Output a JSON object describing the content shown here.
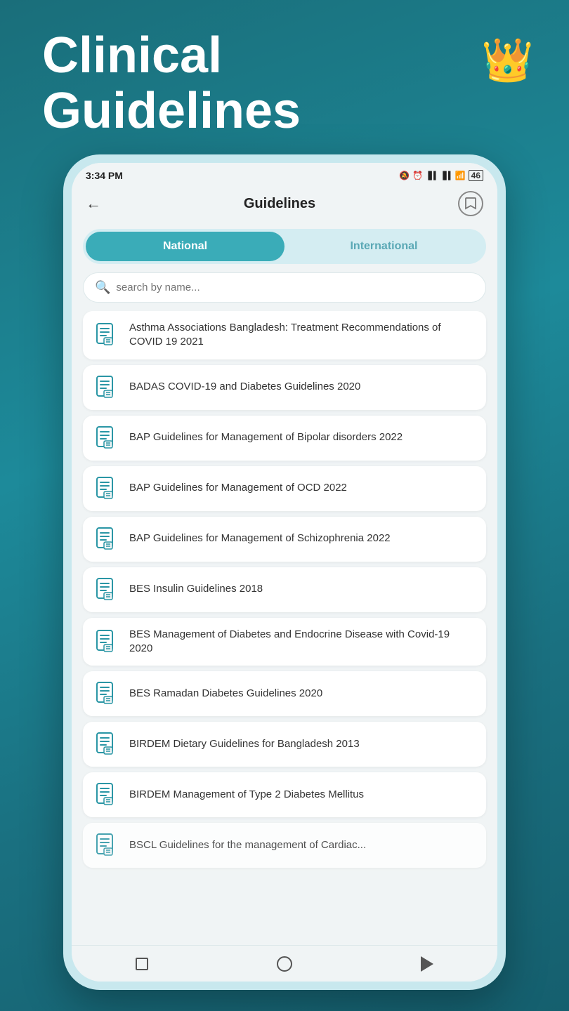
{
  "page": {
    "title_line1": "Clinical",
    "title_line2": "Guidelines",
    "crown_emoji": "👑"
  },
  "status_bar": {
    "time": "3:34 PM",
    "icons": "📵 ⏰  ▌▌ ▌▌ ≋ 46"
  },
  "header": {
    "title": "Guidelines"
  },
  "tabs": {
    "national_label": "National",
    "international_label": "International"
  },
  "search": {
    "placeholder": "search by name..."
  },
  "guidelines": [
    {
      "id": 1,
      "text": "Asthma Associations Bangladesh: Treatment Recommendations of COVID 19 2021"
    },
    {
      "id": 2,
      "text": "BADAS COVID-19 and Diabetes Guidelines 2020"
    },
    {
      "id": 3,
      "text": "BAP Guidelines for Management of Bipolar disorders 2022"
    },
    {
      "id": 4,
      "text": "BAP Guidelines for Management of OCD 2022"
    },
    {
      "id": 5,
      "text": "BAP Guidelines for Management of Schizophrenia 2022"
    },
    {
      "id": 6,
      "text": "BES Insulin Guidelines 2018"
    },
    {
      "id": 7,
      "text": "BES Management of Diabetes and Endocrine Disease with Covid-19 2020"
    },
    {
      "id": 8,
      "text": "BES Ramadan Diabetes Guidelines 2020"
    },
    {
      "id": 9,
      "text": "BIRDEM Dietary Guidelines for Bangladesh 2013"
    },
    {
      "id": 10,
      "text": "BIRDEM Management of Type 2 Diabetes Mellitus"
    },
    {
      "id": 11,
      "text": "BSCL Guidelines for the management of Cardiac..."
    }
  ]
}
